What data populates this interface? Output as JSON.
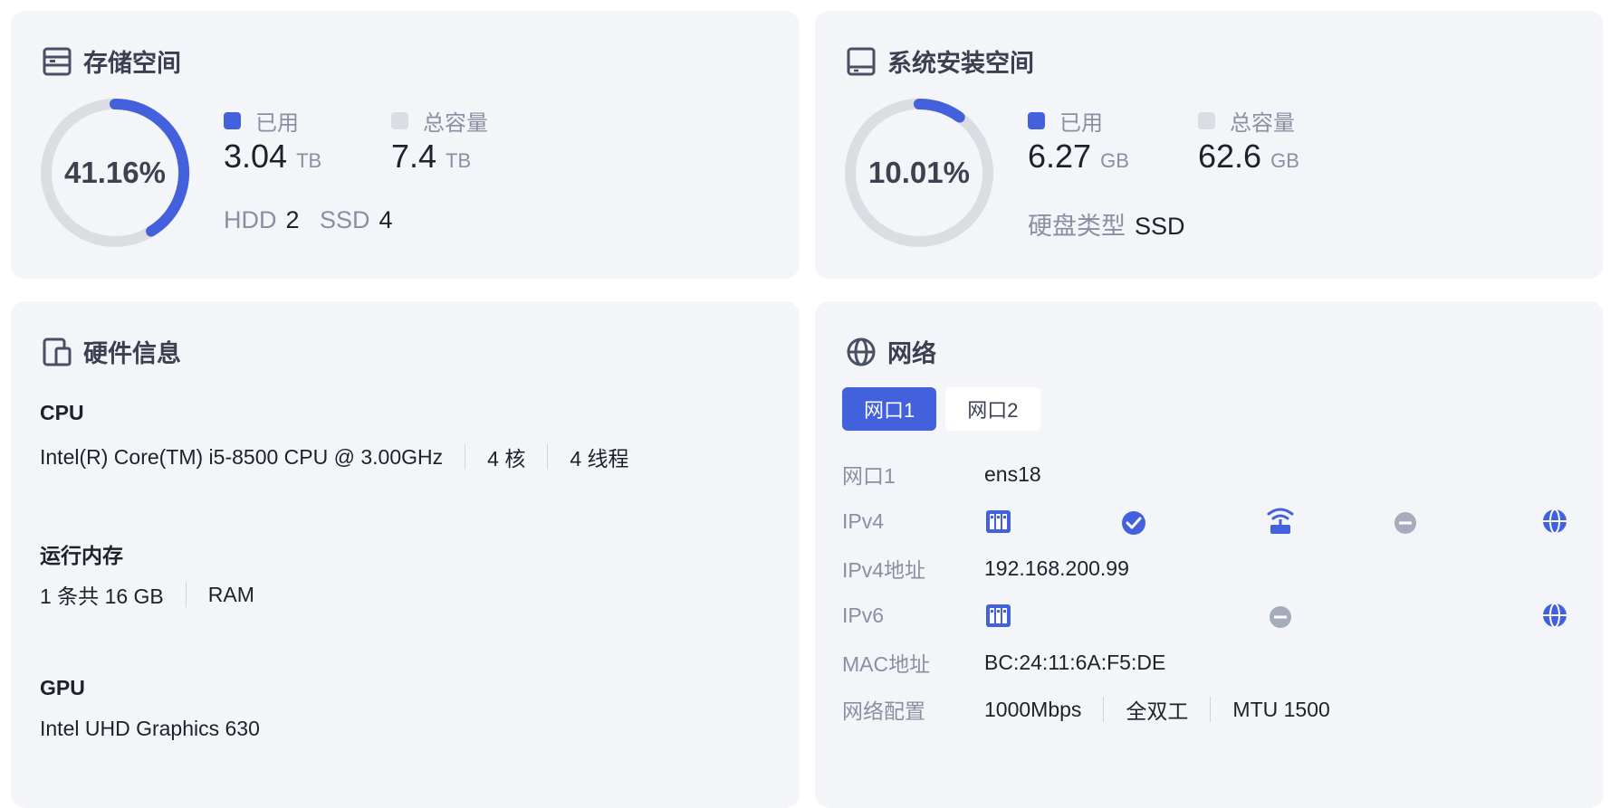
{
  "storage": {
    "title": "存储空间",
    "percent_text": "41.16%",
    "percent": 0.4116,
    "used_label": "已用",
    "used_value": "3.04",
    "used_unit": "TB",
    "total_label": "总容量",
    "total_value": "7.4",
    "total_unit": "TB",
    "hdd_label": "HDD",
    "hdd_count": "2",
    "ssd_label": "SSD",
    "ssd_count": "4"
  },
  "system": {
    "title": "系统安装空间",
    "percent_text": "10.01%",
    "percent": 0.1001,
    "used_label": "已用",
    "used_value": "6.27",
    "used_unit": "GB",
    "total_label": "总容量",
    "total_value": "62.6",
    "total_unit": "GB",
    "disk_type_label": "硬盘类型",
    "disk_type_value": "SSD"
  },
  "hardware": {
    "title": "硬件信息",
    "cpu_label": "CPU",
    "cpu_model": "Intel(R) Core(TM) i5-8500 CPU @ 3.00GHz",
    "cpu_cores": "4 核",
    "cpu_threads": "4 线程",
    "ram_label": "运行内存",
    "ram_summary": "1 条共 16 GB",
    "ram_type": "RAM",
    "gpu_label": "GPU",
    "gpu_model": "Intel UHD Graphics 630"
  },
  "network": {
    "title": "网络",
    "tabs": [
      "网口1",
      "网口2"
    ],
    "active_tab": 0,
    "rows": {
      "port_label": "网口1",
      "port_value": "ens18",
      "ipv4_label": "IPv4",
      "ipv4_addr_label": "IPv4地址",
      "ipv4_addr_value": "192.168.200.99",
      "ipv6_label": "IPv6",
      "mac_label": "MAC地址",
      "mac_value": "BC:24:11:6A:F5:DE",
      "config_label": "网络配置",
      "speed": "1000Mbps",
      "duplex": "全双工",
      "mtu": "MTU 1500"
    }
  },
  "colors": {
    "accent": "#4361dc",
    "track": "#dcdde3",
    "muted_text": "#8a90a2",
    "card_bg": "#f4f5f9",
    "status_gray": "#a6acbb"
  },
  "icons": {
    "storage": "storage-server-icon",
    "system": "system-disk-icon",
    "hardware": "devices-icon",
    "network": "globe-icon",
    "nic": "network-card-icon",
    "router": "router-icon",
    "internet": "globe-icon",
    "ok": "check-circle-icon",
    "blocked": "minus-circle-icon"
  }
}
